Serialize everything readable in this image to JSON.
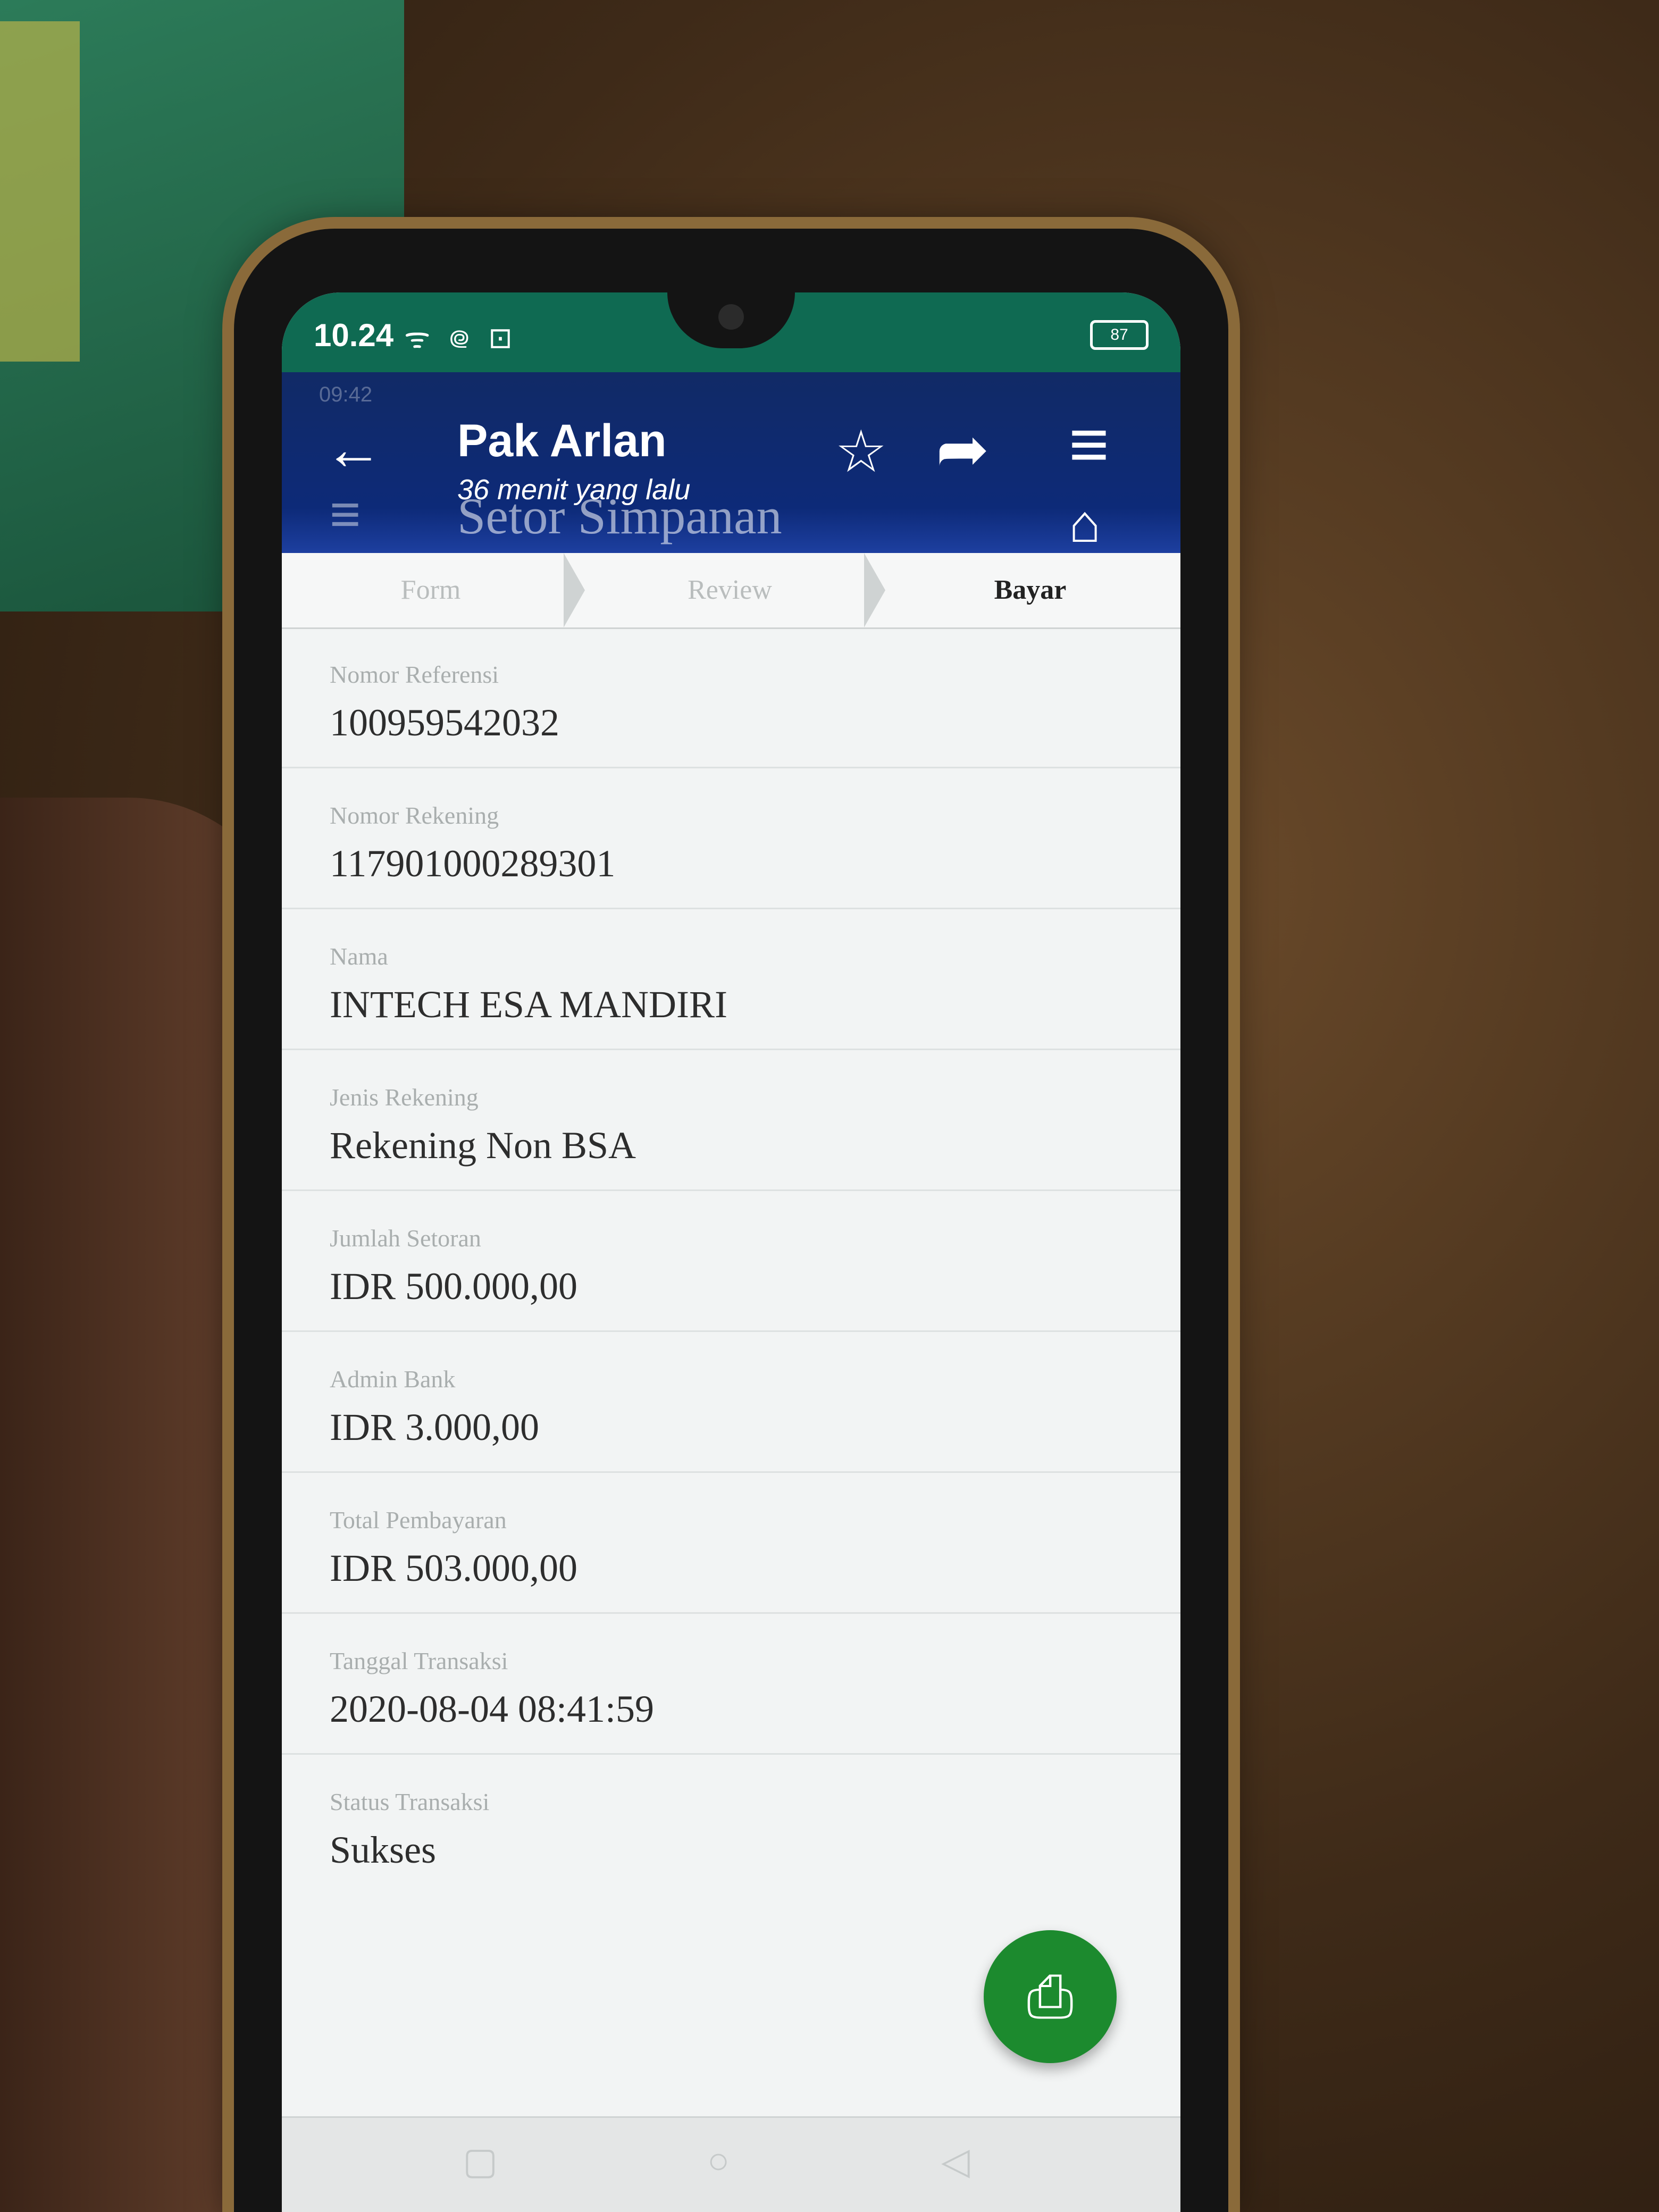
{
  "status_bar": {
    "time": "10.24",
    "signal_text": "ᯤ ᪤ ⊡",
    "battery": "87"
  },
  "header": {
    "chat_name": "Pak Arlan",
    "chat_time": "36 menit yang lalu",
    "page_title": "Setor Simpanan",
    "ghost_time": "09:42"
  },
  "icons": {
    "back": "←",
    "star": "☆",
    "share": "➦",
    "menu": "≡",
    "home": "⌂",
    "ghost_menu": "≡",
    "print": "⎙"
  },
  "steps": [
    "Form",
    "Review",
    "Bayar"
  ],
  "details": [
    {
      "label": "Nomor Referensi",
      "value": "100959542032"
    },
    {
      "label": "Nomor Rekening",
      "value": "117901000289301"
    },
    {
      "label": "Nama",
      "value": "INTECH ESA MANDIRI"
    },
    {
      "label": "Jenis Rekening",
      "value": "Rekening Non BSA"
    },
    {
      "label": "Jumlah Setoran",
      "value": "IDR 500.000,00"
    },
    {
      "label": "Admin Bank",
      "value": "IDR 3.000,00"
    },
    {
      "label": "Total Pembayaran",
      "value": "IDR 503.000,00"
    },
    {
      "label": "Tanggal Transaksi",
      "value": "2020-08-04 08:41:59"
    },
    {
      "label": "Status Transaksi",
      "value": "Sukses"
    }
  ],
  "navbar": {
    "menu": "▢",
    "home": "○",
    "back": "◁"
  },
  "colors": {
    "statusbar": "#0f6a52",
    "toolbar": "#0d2a78",
    "fab": "#1c8a2e"
  }
}
